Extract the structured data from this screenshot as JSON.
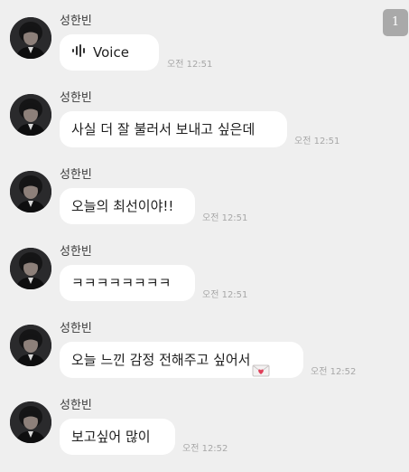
{
  "unread_count": "1",
  "messages": [
    {
      "sender": "성한빈",
      "type": "voice",
      "text": "Voice",
      "icon": "voice-wave-icon",
      "time": "오전 12:51"
    },
    {
      "sender": "성한빈",
      "type": "text",
      "text": "사실 더 잘 불러서 보내고 싶은데",
      "time": "오전 12:51"
    },
    {
      "sender": "성한빈",
      "type": "text",
      "text": "오늘의 최선이야!!",
      "time": "오전 12:51"
    },
    {
      "sender": "성한빈",
      "type": "text",
      "text": "ㅋㅋㅋㅋㅋㅋㅋㅋ",
      "time": "오전 12:51"
    },
    {
      "sender": "성한빈",
      "type": "text",
      "text": "오늘 느낀 감정 전해주고 싶어서",
      "emoji": "love-letter-icon",
      "time": "오전 12:52"
    },
    {
      "sender": "성한빈",
      "type": "text",
      "text": "보고싶어 많이",
      "time": "오전 12:52"
    }
  ],
  "colors": {
    "background": "#efefef",
    "bubble": "#ffffff",
    "timestamp": "#a7a7a7",
    "badge": "#a9a9a9"
  }
}
